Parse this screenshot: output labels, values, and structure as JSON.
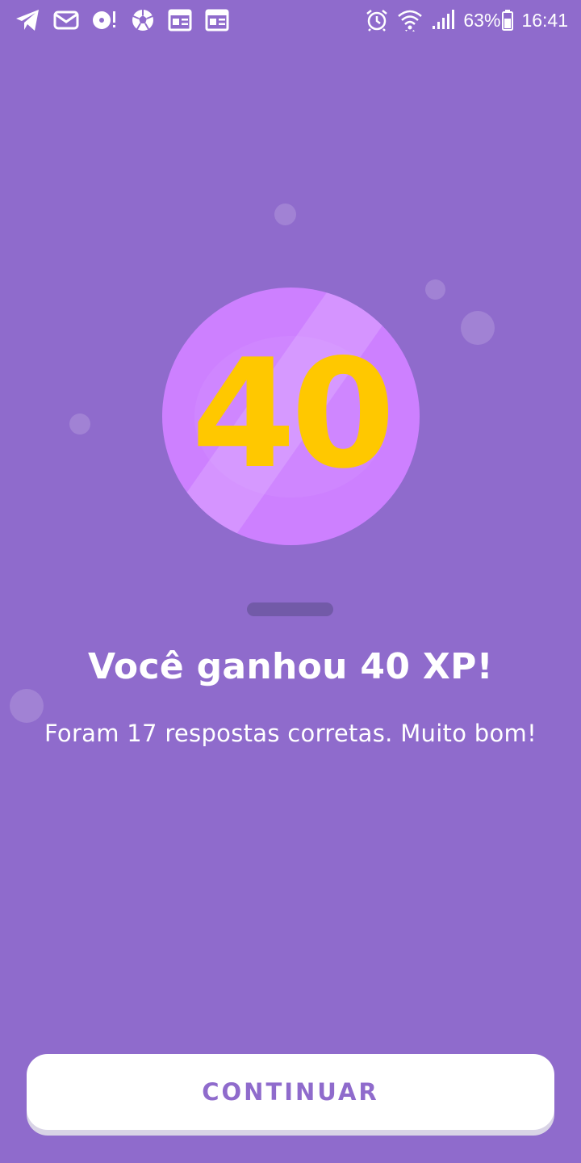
{
  "status_bar": {
    "left_icons": [
      "telegram-icon",
      "mail-icon",
      "disc-alert-icon",
      "soccer-ball-icon",
      "news-icon",
      "news-icon"
    ],
    "right_icons": [
      "alarm-icon",
      "wifi-icon",
      "signal-icon",
      "battery-icon"
    ],
    "battery_percent": "63%",
    "time": "16:41"
  },
  "reward": {
    "xp_value": "40",
    "title": "Você ganhou 40 XP!",
    "subtitle": "Foram 17 respostas corretas. Muito bom!"
  },
  "actions": {
    "continue_label": "CONTINUAR"
  },
  "colors": {
    "background": "#8f6bcc",
    "medallion": "#cd80ff",
    "xp_number": "#ffc800",
    "button_bg": "#ffffff",
    "button_text": "#8f6bcc",
    "divider": "#725aa8"
  }
}
